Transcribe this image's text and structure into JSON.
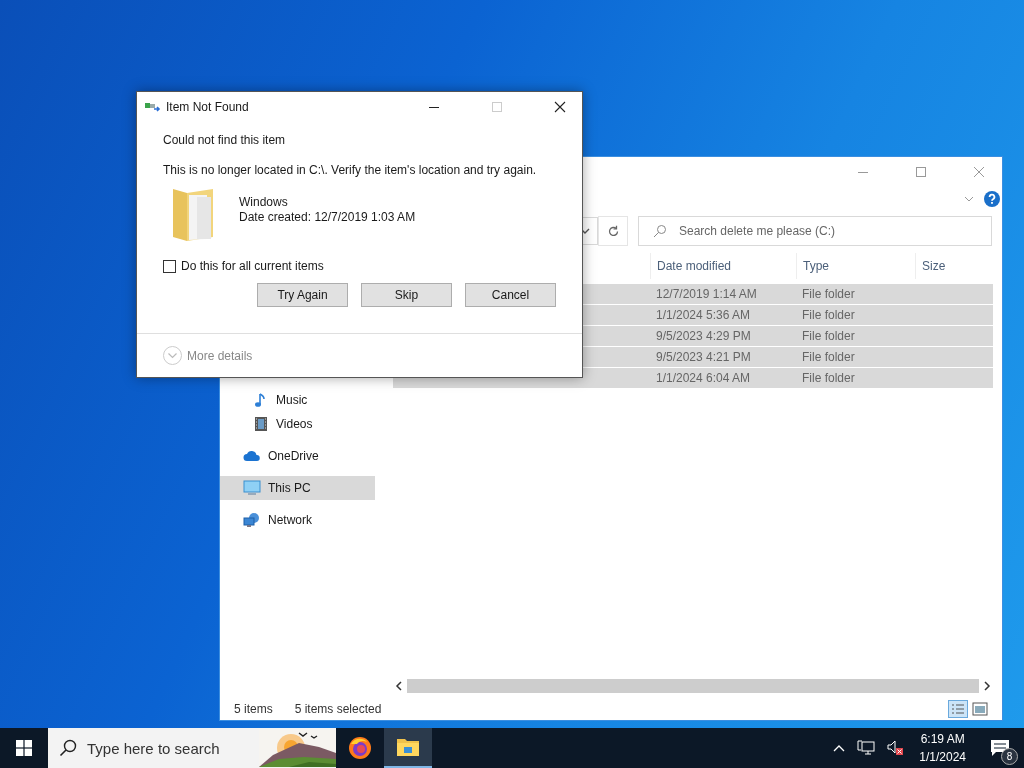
{
  "explorer": {
    "search": {
      "placeholder": "Search delete me please (C:)"
    },
    "sidebar": {
      "child_items": [
        {
          "label": "Music",
          "kind": "music",
          "selected": false
        },
        {
          "label": "Videos",
          "kind": "videos",
          "selected": false
        }
      ],
      "items": [
        {
          "label": "OneDrive",
          "kind": "cloud",
          "selected": false
        },
        {
          "label": "This PC",
          "kind": "pc",
          "selected": true
        },
        {
          "label": "Network",
          "kind": "network",
          "selected": false
        }
      ]
    },
    "columns": [
      "Date modified",
      "Type",
      "Size"
    ],
    "rows": [
      {
        "date_modified": "12/7/2019 1:14 AM",
        "type": "File folder",
        "selected": true
      },
      {
        "date_modified": "1/1/2024 5:36 AM",
        "type": "File folder",
        "selected": true
      },
      {
        "date_modified": "9/5/2023 4:29 PM",
        "type": "File folder",
        "selected": true
      },
      {
        "date_modified": "9/5/2023 4:21 PM",
        "type": "File folder",
        "selected": true
      },
      {
        "date_modified": "1/1/2024 6:04 AM",
        "type": "File folder",
        "selected": true
      }
    ],
    "status_bar": {
      "count": "5 items",
      "selection": "5 items selected"
    }
  },
  "dialog": {
    "title": "Item Not Found",
    "heading": "Could not find this item",
    "message": "This is no longer located in C:\\. Verify the item's location and try again.",
    "item": {
      "name": "Windows",
      "date_created": "Date created: 12/7/2019 1:03 AM"
    },
    "checkbox": {
      "label": "Do this for all current items",
      "checked": false
    },
    "buttons": [
      "Try Again",
      "Skip",
      "Cancel"
    ],
    "more_details": "More details"
  },
  "taskbar": {
    "search": {
      "placeholder": "Type here to search"
    },
    "apps": [
      {
        "kind": "firefox",
        "active": false
      },
      {
        "kind": "explorer",
        "active": true
      }
    ],
    "clock": {
      "time": "6:19 AM",
      "date": "1/1/2024"
    },
    "notifications": {
      "count": "8"
    }
  }
}
